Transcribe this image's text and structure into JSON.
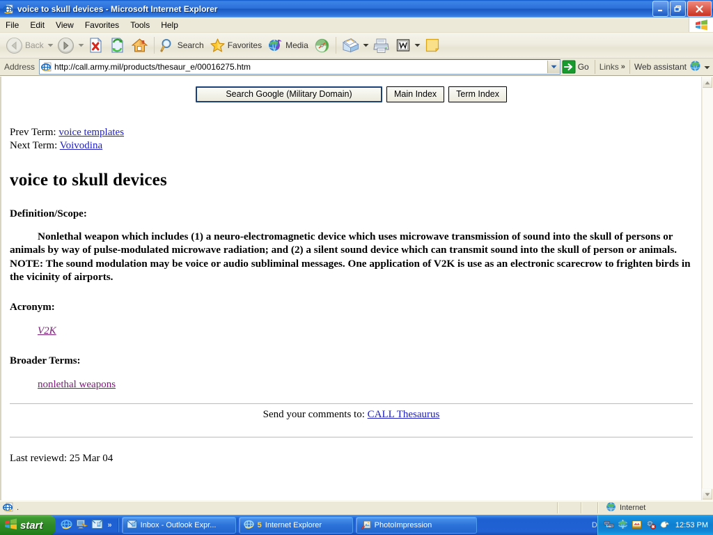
{
  "window": {
    "title": "voice to skull devices - Microsoft Internet Explorer",
    "minimize_label": "Minimize",
    "restore_label": "Restore",
    "close_label": "Close"
  },
  "menu": {
    "items": [
      "File",
      "Edit",
      "View",
      "Favorites",
      "Tools",
      "Help"
    ]
  },
  "toolbar": {
    "back": "Back",
    "search": "Search",
    "favorites": "Favorites",
    "media": "Media"
  },
  "address": {
    "label": "Address",
    "url": "http://call.army.mil/products/thesaur_e/00016275.htm",
    "go": "Go",
    "links": "Links",
    "links_chevron": "»",
    "web_assistant": "Web assistant"
  },
  "page": {
    "buttons": {
      "search_google": "Search Google (Military Domain)",
      "main_index": "Main Index",
      "term_index": "Term Index"
    },
    "prev_term_label": "Prev Term:",
    "prev_term_link": "voice templates",
    "next_term_label": "Next Term:",
    "next_term_link": "Voivodina",
    "title": "voice to skull devices",
    "definition_label": "Definition/Scope:",
    "definition_body": "Nonlethal weapon which includes (1) a neuro-electromagnetic device which uses microwave transmission of sound into the skull of persons or animals by way of pulse-modulated microwave radiation; and (2) a silent sound device which can transmit sound into the skull of person or animals. NOTE: The sound modulation may be voice or audio subliminal messages. One application of V2K is use as an electronic scarecrow to frighten birds in the vicinity of airports.",
    "acronym_label": "Acronym:",
    "acronym_link": "V2K",
    "broader_label": "Broader Terms:",
    "broader_link": "nonlethal weapons",
    "comments_text": "Send your comments to:",
    "comments_link": "CALL Thesaurus",
    "last_reviewed": "Last reviewd: 25 Mar 04"
  },
  "statusbar": {
    "message": ".",
    "zone": "Internet"
  },
  "taskbar": {
    "start": "start",
    "quicklaunch_chevron": "»",
    "tasks": [
      {
        "label": "Inbox - Outlook Expr...",
        "count": ""
      },
      {
        "label": "Internet Explorer",
        "count": "5"
      },
      {
        "label": "PhotoImpression",
        "count": ""
      }
    ],
    "overflow_letter": "D",
    "overflow_chevron": "»",
    "clock": "12:53 PM"
  },
  "colors": {
    "titlebar_blue": "#1957c0",
    "taskbar_blue": "#2061d4",
    "start_green": "#2f8a26",
    "link_blue": "#2020c0",
    "visited_purple": "#7b1a78",
    "chrome_beige": "#ece9d8"
  }
}
